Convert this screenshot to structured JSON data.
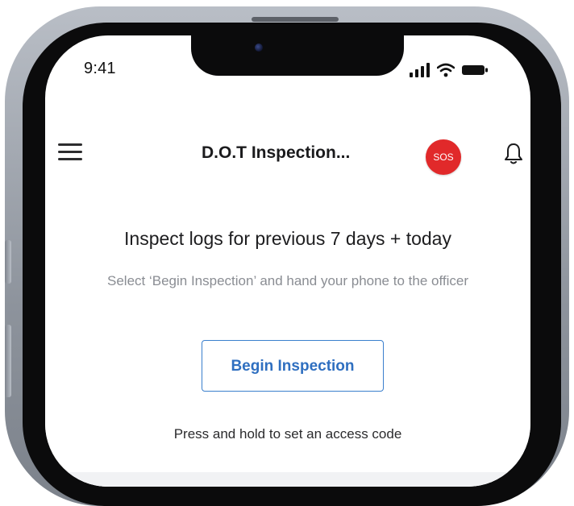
{
  "status_bar": {
    "time": "9:41",
    "signal_icon": "cellular-signal-icon",
    "wifi_icon": "wifi-icon",
    "battery_icon": "battery-icon"
  },
  "header": {
    "menu_icon": "hamburger-menu-icon",
    "title": "D.O.T Inspection...",
    "sos_label": "SOS",
    "sos_color": "#e1292a",
    "bell_icon": "bell-icon"
  },
  "content": {
    "heading": "Inspect logs for previous 7 days + today",
    "subtitle": "Select ‘Begin Inspection’ and hand your phone to the officer",
    "begin_button_label": "Begin Inspection",
    "accent_color": "#2f6fc0",
    "hint": "Press and hold to set an access code"
  }
}
